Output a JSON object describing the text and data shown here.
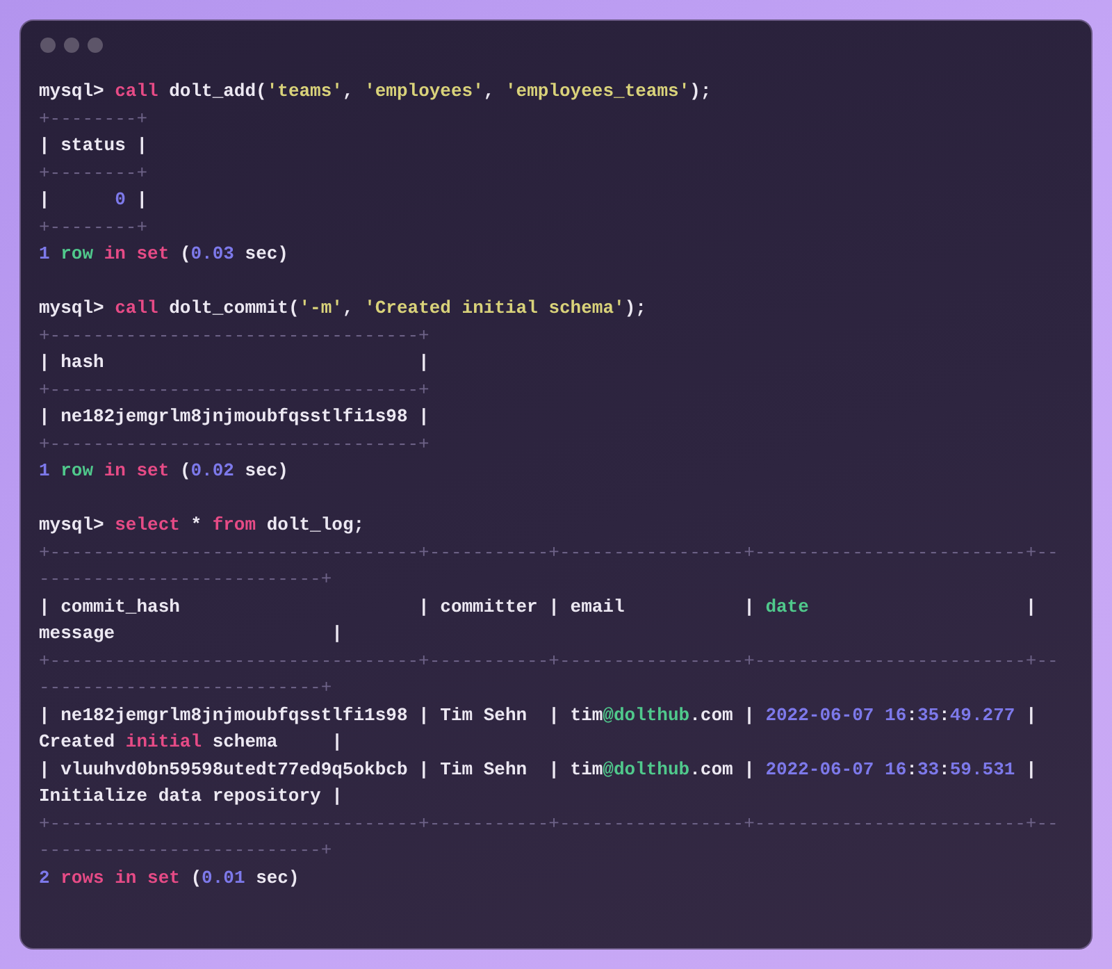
{
  "terminal": {
    "blocks": [
      {
        "lines": [
          [
            {
              "kind": "text",
              "text": "mysql> "
            },
            {
              "kind": "keyword",
              "text": "call"
            },
            {
              "kind": "text",
              "text": " dolt_add("
            },
            {
              "kind": "string",
              "text": "'teams'"
            },
            {
              "kind": "text",
              "text": ", "
            },
            {
              "kind": "string",
              "text": "'employees'"
            },
            {
              "kind": "text",
              "text": ", "
            },
            {
              "kind": "string",
              "text": "'employees_teams'"
            },
            {
              "kind": "text",
              "text": ");"
            }
          ],
          [
            {
              "kind": "border",
              "text": "+--------+"
            }
          ],
          [
            {
              "kind": "text",
              "text": "| status |"
            }
          ],
          [
            {
              "kind": "border",
              "text": "+--------+"
            }
          ],
          [
            {
              "kind": "text",
              "text": "|      "
            },
            {
              "kind": "number",
              "text": "0"
            },
            {
              "kind": "text",
              "text": " |"
            }
          ],
          [
            {
              "kind": "border",
              "text": "+--------+"
            }
          ],
          [
            {
              "kind": "number",
              "text": "1"
            },
            {
              "kind": "accent",
              "text": " row"
            },
            {
              "kind": "keyword",
              "text": " in set"
            },
            {
              "kind": "text",
              "text": " ("
            },
            {
              "kind": "number",
              "text": "0.03"
            },
            {
              "kind": "text",
              "text": " sec)"
            }
          ]
        ]
      },
      {
        "lines": [
          [
            {
              "kind": "text",
              "text": "mysql> "
            },
            {
              "kind": "keyword",
              "text": "call"
            },
            {
              "kind": "text",
              "text": " dolt_commit("
            },
            {
              "kind": "string",
              "text": "'-m'"
            },
            {
              "kind": "text",
              "text": ", "
            },
            {
              "kind": "string",
              "text": "'Created initial schema'"
            },
            {
              "kind": "text",
              "text": ");"
            }
          ],
          [
            {
              "kind": "border",
              "text": "+----------------------------------+"
            }
          ],
          [
            {
              "kind": "text",
              "text": "| hash                             |"
            }
          ],
          [
            {
              "kind": "border",
              "text": "+----------------------------------+"
            }
          ],
          [
            {
              "kind": "text",
              "text": "| ne182jemgrlm8jnjmoubfqsstlfi1s98 |"
            }
          ],
          [
            {
              "kind": "border",
              "text": "+----------------------------------+"
            }
          ],
          [
            {
              "kind": "number",
              "text": "1"
            },
            {
              "kind": "accent",
              "text": " row"
            },
            {
              "kind": "keyword",
              "text": " in set"
            },
            {
              "kind": "text",
              "text": " ("
            },
            {
              "kind": "number",
              "text": "0.02"
            },
            {
              "kind": "text",
              "text": " sec)"
            }
          ]
        ]
      },
      {
        "lines": [
          [
            {
              "kind": "text",
              "text": "mysql> "
            },
            {
              "kind": "keyword",
              "text": "select"
            },
            {
              "kind": "text",
              "text": " * "
            },
            {
              "kind": "keyword",
              "text": "from"
            },
            {
              "kind": "text",
              "text": " dolt_log;"
            }
          ],
          [
            {
              "kind": "border",
              "text": "+----------------------------------+-----------+-----------------+-------------------------+--"
            }
          ],
          [
            {
              "kind": "border",
              "text": "--------------------------+"
            }
          ],
          [
            {
              "kind": "text",
              "text": "| commit_hash                      | committer | email           | "
            },
            {
              "kind": "accent",
              "text": "date"
            },
            {
              "kind": "text",
              "text": "                    |"
            }
          ],
          [
            {
              "kind": "text",
              "text": "message                    |"
            }
          ],
          [
            {
              "kind": "border",
              "text": "+----------------------------------+-----------+-----------------+-------------------------+--"
            }
          ],
          [
            {
              "kind": "border",
              "text": "--------------------------+"
            }
          ],
          [
            {
              "kind": "text",
              "text": "| ne182jemgrlm8jnjmoubfqsstlfi1s98 | Tim Sehn  | tim"
            },
            {
              "kind": "accent",
              "text": "@dolthub"
            },
            {
              "kind": "text",
              "text": ".com | "
            },
            {
              "kind": "number",
              "text": "2022-06-07 16"
            },
            {
              "kind": "text",
              "text": ":"
            },
            {
              "kind": "number",
              "text": "35"
            },
            {
              "kind": "text",
              "text": ":"
            },
            {
              "kind": "number",
              "text": "49.277"
            },
            {
              "kind": "text",
              "text": " |"
            }
          ],
          [
            {
              "kind": "text",
              "text": "Created "
            },
            {
              "kind": "keyword",
              "text": "initial"
            },
            {
              "kind": "text",
              "text": " schema     |"
            }
          ],
          [
            {
              "kind": "text",
              "text": "| vluuhvd0bn59598utedt77ed9q5okbcb | Tim Sehn  | tim"
            },
            {
              "kind": "accent",
              "text": "@dolthub"
            },
            {
              "kind": "text",
              "text": ".com | "
            },
            {
              "kind": "number",
              "text": "2022-06-07 16"
            },
            {
              "kind": "text",
              "text": ":"
            },
            {
              "kind": "number",
              "text": "33"
            },
            {
              "kind": "text",
              "text": ":"
            },
            {
              "kind": "number",
              "text": "59.531"
            },
            {
              "kind": "text",
              "text": " |"
            }
          ],
          [
            {
              "kind": "text",
              "text": "Initialize data repository |"
            }
          ],
          [
            {
              "kind": "border",
              "text": "+----------------------------------+-----------+-----------------+-------------------------+--"
            }
          ],
          [
            {
              "kind": "border",
              "text": "--------------------------+"
            }
          ],
          [
            {
              "kind": "number",
              "text": "2"
            },
            {
              "kind": "keyword",
              "text": " rows in set"
            },
            {
              "kind": "text",
              "text": " ("
            },
            {
              "kind": "number",
              "text": "0.01"
            },
            {
              "kind": "text",
              "text": " sec)"
            }
          ]
        ]
      }
    ]
  }
}
